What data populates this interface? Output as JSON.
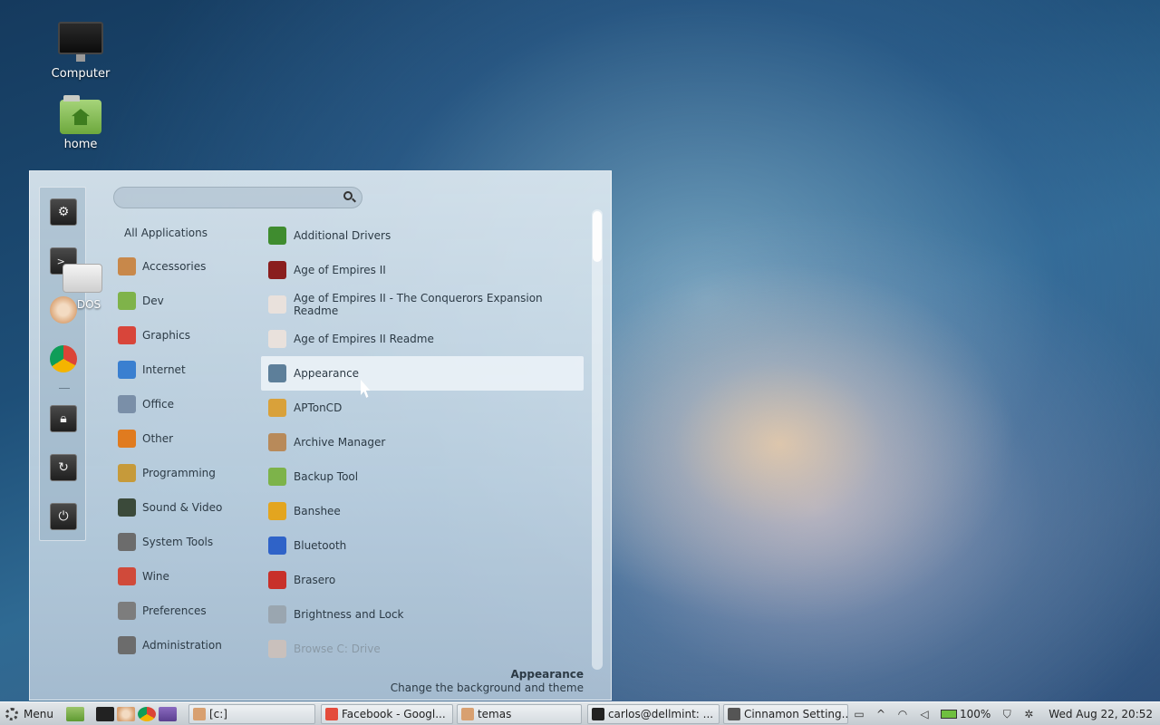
{
  "desktop": {
    "icons": [
      {
        "label": "Computer"
      },
      {
        "label": "home"
      },
      {
        "label": "DOS"
      }
    ]
  },
  "menu": {
    "search": {
      "value": "",
      "placeholder": ""
    },
    "favorites": [
      {
        "name": "system-settings"
      },
      {
        "name": "terminal"
      },
      {
        "name": "software-manager"
      },
      {
        "name": "chrome"
      },
      {
        "name": "lock-screen"
      },
      {
        "name": "logout"
      },
      {
        "name": "shutdown"
      }
    ],
    "categories_all": "All Applications",
    "categories": [
      {
        "label": "Accessories",
        "color": "#c8884a"
      },
      {
        "label": "Dev",
        "color": "#7fb34a"
      },
      {
        "label": "Graphics",
        "color": "#d8453a"
      },
      {
        "label": "Internet",
        "color": "#3a7fd0"
      },
      {
        "label": "Office",
        "color": "#7a8fa8"
      },
      {
        "label": "Other",
        "color": "#e07b1f"
      },
      {
        "label": "Programming",
        "color": "#c69a3a"
      },
      {
        "label": "Sound & Video",
        "color": "#3b4a3a"
      },
      {
        "label": "System Tools",
        "color": "#6c6c6c"
      },
      {
        "label": "Wine",
        "color": "#d04a3a"
      },
      {
        "label": "Preferences",
        "color": "#7d7d7d"
      },
      {
        "label": "Administration",
        "color": "#6c6c6c"
      }
    ],
    "apps": [
      {
        "label": "Additional Drivers",
        "color": "#3f8c2f"
      },
      {
        "label": "Age of Empires II",
        "color": "#8a1e1e"
      },
      {
        "label": "Age of Empires II - The Conquerors Expansion Readme",
        "color": "#e9e1dc"
      },
      {
        "label": "Age of Empires II Readme",
        "color": "#e9e1dc"
      },
      {
        "label": "Appearance",
        "color": "#5d7f9a"
      },
      {
        "label": "APTonCD",
        "color": "#d9a13a"
      },
      {
        "label": "Archive Manager",
        "color": "#b88a5a"
      },
      {
        "label": "Backup Tool",
        "color": "#7db34a"
      },
      {
        "label": "Banshee",
        "color": "#e3a51f"
      },
      {
        "label": "Bluetooth",
        "color": "#2f63c8"
      },
      {
        "label": "Brasero",
        "color": "#c8302a"
      },
      {
        "label": "Brightness and Lock",
        "color": "#9aa6b0"
      },
      {
        "label": "Browse C: Drive",
        "color": "#c9c0bc"
      }
    ],
    "selected": {
      "title": "Appearance",
      "description": "Change the background and theme"
    }
  },
  "taskbar": {
    "menu_label": "Menu",
    "windows": [
      {
        "label": "[c:]",
        "color": "#d8a070"
      },
      {
        "label": "Facebook - Googl...",
        "color": "#e44c3c"
      },
      {
        "label": "temas",
        "color": "#d8a070"
      },
      {
        "label": "carlos@dellmint: ...",
        "color": "#222222"
      },
      {
        "label": "Cinnamon Setting...",
        "color": "#555555"
      }
    ],
    "battery": "100%",
    "clock": "Wed Aug 22, 20:52"
  }
}
